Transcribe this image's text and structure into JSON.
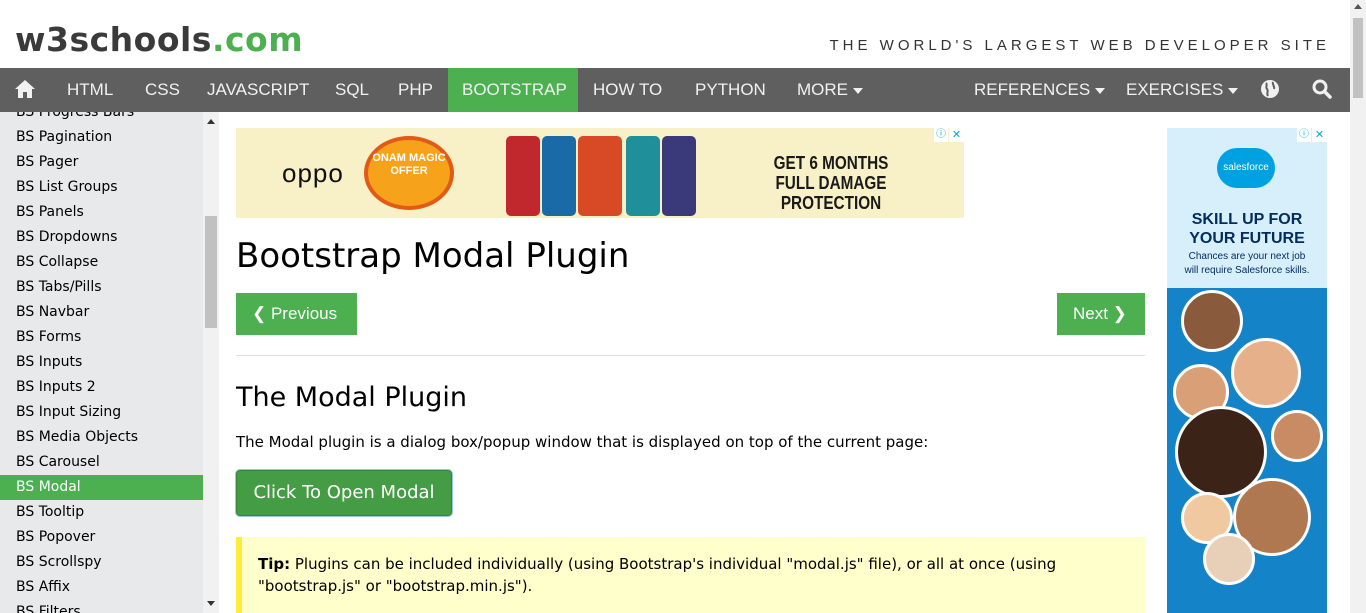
{
  "header": {
    "logo_main": "w3schools",
    "logo_suffix": ".com",
    "tagline": "THE WORLD'S LARGEST WEB DEVELOPER SITE"
  },
  "topnav": {
    "home_icon": "home-icon",
    "items": [
      "HTML",
      "CSS",
      "JAVASCRIPT",
      "SQL",
      "PHP",
      "BOOTSTRAP",
      "HOW TO",
      "PYTHON",
      "MORE"
    ],
    "active": "BOOTSTRAP",
    "references": "REFERENCES",
    "exercises": "EXERCISES",
    "globe_icon": "globe-icon",
    "search_icon": "search-icon"
  },
  "sidebar": {
    "items": [
      "BS Progress Bars",
      "BS Pagination",
      "BS Pager",
      "BS List Groups",
      "BS Panels",
      "BS Dropdowns",
      "BS Collapse",
      "BS Tabs/Pills",
      "BS Navbar",
      "BS Forms",
      "BS Inputs",
      "BS Inputs 2",
      "BS Input Sizing",
      "BS Media Objects",
      "BS Carousel",
      "BS Modal",
      "BS Tooltip",
      "BS Popover",
      "BS Scrollspy",
      "BS Affix",
      "BS Filters"
    ],
    "active_index": 15
  },
  "ad_top": {
    "brand": "oppo",
    "badge": "ONAM MAGIC OFFER",
    "text_line1": "GET 6 MONTHS",
    "text_line2": "FULL DAMAGE PROTECTION"
  },
  "main": {
    "title": "Bootstrap Modal Plugin",
    "prev_label": "❮ Previous",
    "next_label": "Next ❯",
    "section_title": "The Modal Plugin",
    "intro": "The Modal plugin is a dialog box/popup window that is displayed on top of the current page:",
    "modal_button": "Click To Open Modal",
    "tip_label": "Tip:",
    "tip_text": " Plugins can be included individually (using Bootstrap's individual \"modal.js\" file), or all at once (using \"bootstrap.js\" or \"bootstrap.min.js\")."
  },
  "ad_right": {
    "brand": "salesforce",
    "headline_1": "SKILL UP FOR",
    "headline_2": "YOUR FUTURE",
    "sub_1": "Chances are your next job",
    "sub_2": "will require Salesforce skills."
  },
  "colors": {
    "accent": "#4caf50",
    "nav_bg": "#5f5f5f",
    "sidebar_bg": "#e7e9eb",
    "tip_bg": "#ffffcc",
    "tip_border": "#ffeb3b"
  }
}
